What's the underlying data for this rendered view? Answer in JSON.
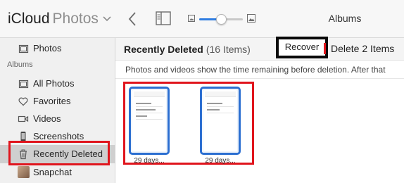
{
  "app": {
    "brand_primary": "iCloud",
    "brand_secondary": "Photos"
  },
  "toolbar": {
    "title": "Albums",
    "zoom_level": 0.5
  },
  "sidebar": {
    "top_item": {
      "label": "Photos",
      "icon": "photos-icon"
    },
    "albums_header": "Albums",
    "items": [
      {
        "label": "All Photos",
        "icon": "all-photos-icon"
      },
      {
        "label": "Favorites",
        "icon": "heart-icon"
      },
      {
        "label": "Videos",
        "icon": "video-camera-icon"
      },
      {
        "label": "Screenshots",
        "icon": "phone-icon"
      },
      {
        "label": "Recently Deleted",
        "icon": "trash-icon",
        "selected": true
      },
      {
        "label": "Snapchat",
        "icon": "album-thumbnail"
      }
    ]
  },
  "main": {
    "section_title": "Recently Deleted",
    "section_count": "(16 Items)",
    "recover_label": "Recover",
    "delete_label": "Delete 2 Items",
    "info_text": "Photos and videos show the time remaining before deletion. After that",
    "items": [
      {
        "caption": "29 days..."
      },
      {
        "caption": "29 days..."
      }
    ]
  },
  "colors": {
    "highlight_red": "#e0151d",
    "selection_blue": "#2c6fd1",
    "recover_outline": "#0a0a0a",
    "accent": "#2f7de1"
  }
}
